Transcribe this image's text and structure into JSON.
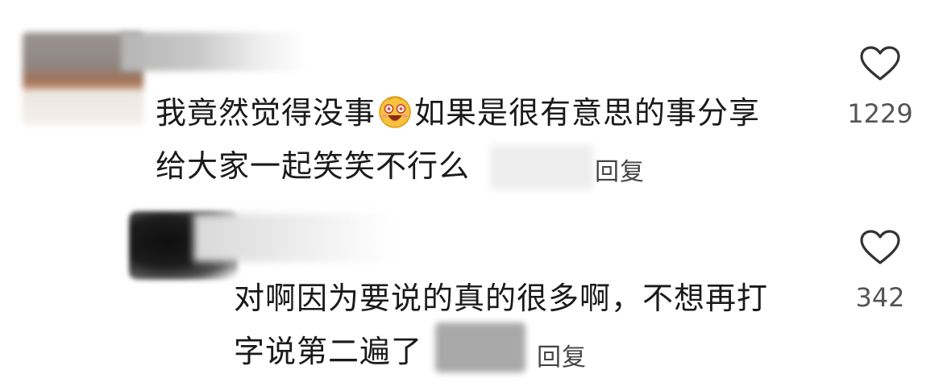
{
  "comments": [
    {
      "text_line_1": "我竟然觉得没事",
      "emoji": "laughing-face-emoji",
      "text_line_1b": "如果是很有意思的事分享",
      "text_line_2": "给大家一起笑笑不行么",
      "reply_label": "回复",
      "like_count": "1229",
      "like_icon": "heart-outline-icon"
    },
    {
      "text_line_1": "对啊因为要说的真的很多啊，不想再打",
      "text_line_2": "字说第二遍了",
      "reply_label": "回复",
      "like_count": "342",
      "like_icon": "heart-outline-icon"
    }
  ],
  "colors": {
    "text": "#1a1a1a",
    "secondary": "#555555",
    "background": "#ffffff"
  }
}
